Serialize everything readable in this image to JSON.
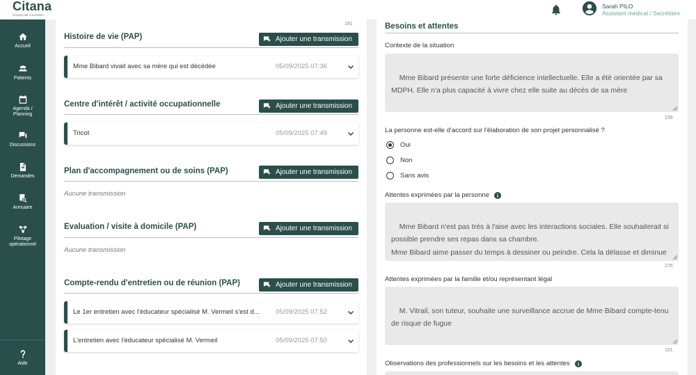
{
  "app": {
    "logo": "Citana",
    "logo_sub": "Groupe par Innovation",
    "user_name": "Sarah PILO",
    "user_role": "Assistant médical / Secrétaire",
    "accent_color": "#2a4f4b"
  },
  "sidebar": {
    "items": [
      {
        "label": "Accueil",
        "icon": "home-icon"
      },
      {
        "label": "Patients",
        "icon": "users-icon"
      },
      {
        "label": "Agenda / Planning",
        "icon": "calendar-icon"
      },
      {
        "label": "Discussions",
        "icon": "chat-icon"
      },
      {
        "label": "Demandes",
        "icon": "document-icon"
      },
      {
        "label": "Annuaire",
        "icon": "directory-search-icon"
      },
      {
        "label": "Pilotage opérationnel",
        "icon": "network-icon"
      }
    ],
    "help_label": "Aide"
  },
  "left": {
    "top_counter": "181",
    "add_label": "Ajouter une transmission",
    "sections": [
      {
        "title": "Histoire de vie (PAP)",
        "entries": [
          {
            "text": "Mme Bibard vivait avec sa mère qui est décédée",
            "date": "05/09/2025 07:36"
          }
        ]
      },
      {
        "title": "Centre d'intérêt / activité occupationnelle",
        "entries": [
          {
            "text": "Tricot",
            "date": "05/09/2025 07:49"
          }
        ]
      },
      {
        "title": "Plan d'accompagnement ou de soins (PAP)",
        "empty": "Aucune transmission"
      },
      {
        "title": "Evaluation / visite à domicile (PAP)",
        "empty": "Aucune transmission"
      },
      {
        "title": "Compte-rendu d'entretien ou de réunion (PAP)",
        "entries": [
          {
            "text": "Le 1er entretien avec l'éducateur spécialisé M. Vermeil s'est d...",
            "date": "05/09/2025 07:52"
          },
          {
            "text": "L'entretien avec l'éducateur spécialisé M. Vermeil",
            "date": "05/09/2025 07:50"
          }
        ]
      }
    ]
  },
  "right": {
    "title": "Besoins et attentes",
    "context": {
      "label": "Contexte de la situation",
      "value": "Mme Bibard présente une forte déficience intellectuelle. Elle a été orientée par sa MDPH. Elle n'a plus capacité à vivre chez elle suite au décès de sa mère",
      "counter": "156"
    },
    "agreement": {
      "question": "La personne est-elle d'accord sur l'élaboration de son projet personnalisé ?",
      "options": [
        "Oui",
        "Non",
        "Sans avis"
      ],
      "selected": "Oui"
    },
    "person_expectations": {
      "label": "Attentes exprimées par la personne",
      "value": "Mme Bibard n'est pas très à l'aise avec les interactions sociales. Elle souhaiterait si possible prendre ses repas dans sa chambre.\nMme Bibard aime passer du temps à dessiner ou peindre. Cela la délasse et diminue son anxiété. Elle aimerait participer à nos ateliers peintures",
      "counter": "276"
    },
    "family_expectations": {
      "label": "Attentes exprimées par la famille et/ou représentant légal",
      "value": "M. Vitrail, son tuteur, souhaite une surveillance accrue de Mme Bibard compte-tenu de risque de fugue",
      "counter": "101"
    },
    "observations": {
      "label": "Observations des professionnels sur les besoins et les attentes"
    }
  }
}
